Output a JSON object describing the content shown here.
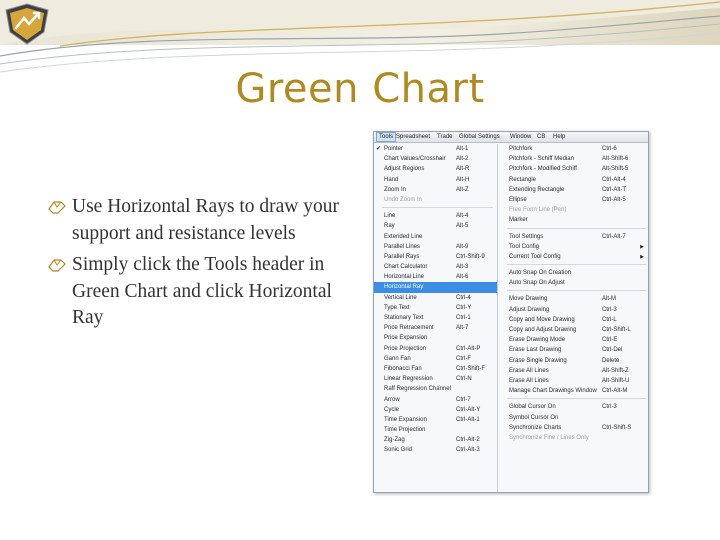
{
  "title": "Green Chart",
  "bullets": [
    "Use Horizontal Rays to draw your support and resistance levels",
    "Simply click the Tools header in Green Chart and click Horizontal Ray"
  ],
  "menubar": [
    "Tools",
    "Spreadsheet",
    "Trade",
    "Global Settings",
    "Window",
    "CB",
    "Help"
  ],
  "menu_left": [
    {
      "label": "Pointer",
      "shortcut": "Alt-1",
      "checked": true
    },
    {
      "label": "Chart Values/Crosshair",
      "shortcut": "Alt-2"
    },
    {
      "label": "Adjust Regions",
      "shortcut": "Alt-R"
    },
    {
      "label": "Hand",
      "shortcut": "Alt-H"
    },
    {
      "label": "Zoom In",
      "shortcut": "Alt-Z"
    },
    {
      "label": "Undo Zoom In",
      "shortcut": "",
      "dim": true
    },
    {
      "sep": true
    },
    {
      "label": "Line",
      "shortcut": "Alt-4"
    },
    {
      "label": "Ray",
      "shortcut": "Alt-5"
    },
    {
      "label": "Extended Line",
      "shortcut": ""
    },
    {
      "label": "Parallel Lines",
      "shortcut": "Alt-9"
    },
    {
      "label": "Parallel Rays",
      "shortcut": "Ctrl-Shift-9"
    },
    {
      "label": "Chart Calculator",
      "shortcut": "Alt-3"
    },
    {
      "label": "Horizontal Line",
      "shortcut": "Alt-6"
    },
    {
      "label": "Horizontal Ray",
      "shortcut": "",
      "highlight": true
    },
    {
      "label": "Vertical Line",
      "shortcut": "Ctrl-4"
    },
    {
      "label": "Type Text",
      "shortcut": "Ctrl-Y"
    },
    {
      "label": "Stationary Text",
      "shortcut": "Ctrl-1"
    },
    {
      "label": "Price Retracement",
      "shortcut": "Alt-7"
    },
    {
      "label": "Price Expansion",
      "shortcut": ""
    },
    {
      "label": "Price Projection",
      "shortcut": "Ctrl-Alt-P"
    },
    {
      "label": "Gann Fan",
      "shortcut": "Ctrl-F"
    },
    {
      "label": "Fibonacci Fan",
      "shortcut": "Ctrl-Shift-F"
    },
    {
      "label": "Linear Regression",
      "shortcut": "Ctrl-N"
    },
    {
      "label": "Raff Regression Channel",
      "shortcut": ""
    },
    {
      "label": "Arrow",
      "shortcut": "Ctrl-7"
    },
    {
      "label": "Cycle",
      "shortcut": "Ctrl-Alt-Y"
    },
    {
      "label": "Time Expansion",
      "shortcut": "Ctrl-Alt-1"
    },
    {
      "label": "Time Projection",
      "shortcut": ""
    },
    {
      "label": "Zig-Zag",
      "shortcut": "Ctrl-Alt-2"
    },
    {
      "label": "Sonic Grid",
      "shortcut": "Ctrl-Alt-3"
    }
  ],
  "menu_right": [
    {
      "label": "Pitchfork",
      "shortcut": "Ctrl-6"
    },
    {
      "label": "Pitchfork - Schiff Median",
      "shortcut": "Alt-Shift-6"
    },
    {
      "label": "Pitchfork - Modified Schiff",
      "shortcut": "Alt-Shift-5"
    },
    {
      "label": "Rectangle",
      "shortcut": "Ctrl-Alt-4"
    },
    {
      "label": "Extending Rectangle",
      "shortcut": "Ctrl-Alt-T"
    },
    {
      "label": "Ellipse",
      "shortcut": "Ctrl-Alt-5"
    },
    {
      "label": "Free Form Line (Pen)",
      "shortcut": "",
      "dim": true
    },
    {
      "label": "Marker",
      "shortcut": ""
    },
    {
      "sep": true
    },
    {
      "label": "Tool Settings",
      "shortcut": "Ctrl-Alt-7"
    },
    {
      "label": "Tool Config",
      "shortcut": "",
      "sub": true
    },
    {
      "label": "Current Tool Config",
      "shortcut": "",
      "sub": true
    },
    {
      "sep": true
    },
    {
      "label": "Auto Snap On Creation",
      "shortcut": ""
    },
    {
      "label": "Auto Snap On Adjust",
      "shortcut": ""
    },
    {
      "sep": true
    },
    {
      "label": "Move Drawing",
      "shortcut": "Alt-M"
    },
    {
      "label": "Adjust Drawing",
      "shortcut": "Ctrl-3"
    },
    {
      "label": "Copy and Move Drawing",
      "shortcut": "Ctrl-L"
    },
    {
      "label": "Copy and Adjust Drawing",
      "shortcut": "Ctrl-Shift-L"
    },
    {
      "label": "Erase Drawing Mode",
      "shortcut": "Ctrl-E"
    },
    {
      "label": "Erase Last Drawing",
      "shortcut": "Ctrl-Del"
    },
    {
      "label": "Erase Single Drawing",
      "shortcut": "Delete"
    },
    {
      "label": "Erase All Lines",
      "shortcut": "Alt-Shift-Z"
    },
    {
      "label": "Erase All Lines",
      "shortcut": "Alt-Shift-U"
    },
    {
      "label": "Manage Chart Drawings Window",
      "shortcut": "Ctrl-Alt-M"
    },
    {
      "sep": true
    },
    {
      "label": "Global Cursor On",
      "shortcut": "Ctrl-3"
    },
    {
      "label": "Symbol Cursor On",
      "shortcut": ""
    },
    {
      "label": "Synchronize Charts",
      "shortcut": "Ctrl-Shift-S"
    },
    {
      "label": "Synchronize Fine / Lines Only",
      "shortcut": "",
      "dim": true
    }
  ]
}
